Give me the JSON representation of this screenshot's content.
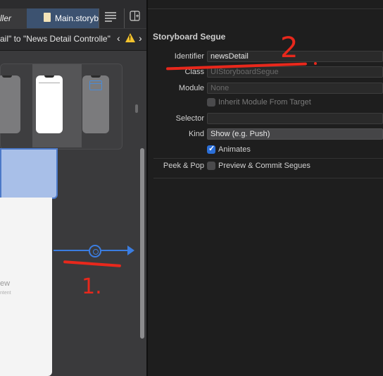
{
  "editor": {
    "tabs": [
      {
        "label": "ller"
      },
      {
        "label": "Main.storyb"
      }
    ],
    "jumpbar": {
      "path": "ail\" to \"News Detail Controlle\"",
      "back": "‹",
      "forward": "›",
      "warning_glyph": "!"
    },
    "scene": {
      "title_fragment": "ew",
      "subtitle_fragment": "ntent"
    }
  },
  "annotations": {
    "step1": "1.",
    "step2": "2"
  },
  "inspector": {
    "section_title": "Storyboard Segue",
    "identifier": {
      "label": "Identifier",
      "value": "newsDetail"
    },
    "class": {
      "label": "Class",
      "placeholder": "UIStoryboardSegue"
    },
    "module": {
      "label": "Module",
      "placeholder": "None"
    },
    "inherit": {
      "label": "Inherit Module From Target",
      "checked": false
    },
    "selector": {
      "label": "Selector",
      "value": ""
    },
    "kind": {
      "label": "Kind",
      "value": "Show (e.g. Push)"
    },
    "animates": {
      "label": "Animates",
      "checked": true
    },
    "peek_pop": {
      "label": "Peek & Pop",
      "option": "Preview & Commit Segues",
      "checked": false
    }
  },
  "colors": {
    "accent": "#2b6fd8",
    "segue": "#3b7de0",
    "annotation": "#e8281c",
    "tab_selected": "#3c5270"
  }
}
